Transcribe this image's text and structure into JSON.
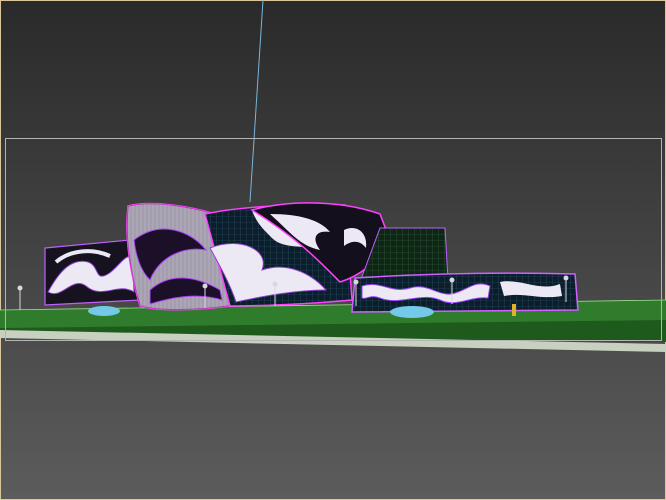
{
  "viewport": {
    "background_top": "#2a2a2a",
    "background_bottom": "#5a5a5a",
    "outer_border": "#d8c89a",
    "safe_frame": "#b4b4b4",
    "camera_line": "#7ab6d8",
    "selection_wire": "#ff40ff",
    "grass_color": "#2f7d2c",
    "ground_color": "#1f5a1d",
    "path_color": "#c8d0c0",
    "shrub_color": "#74c8e8"
  }
}
